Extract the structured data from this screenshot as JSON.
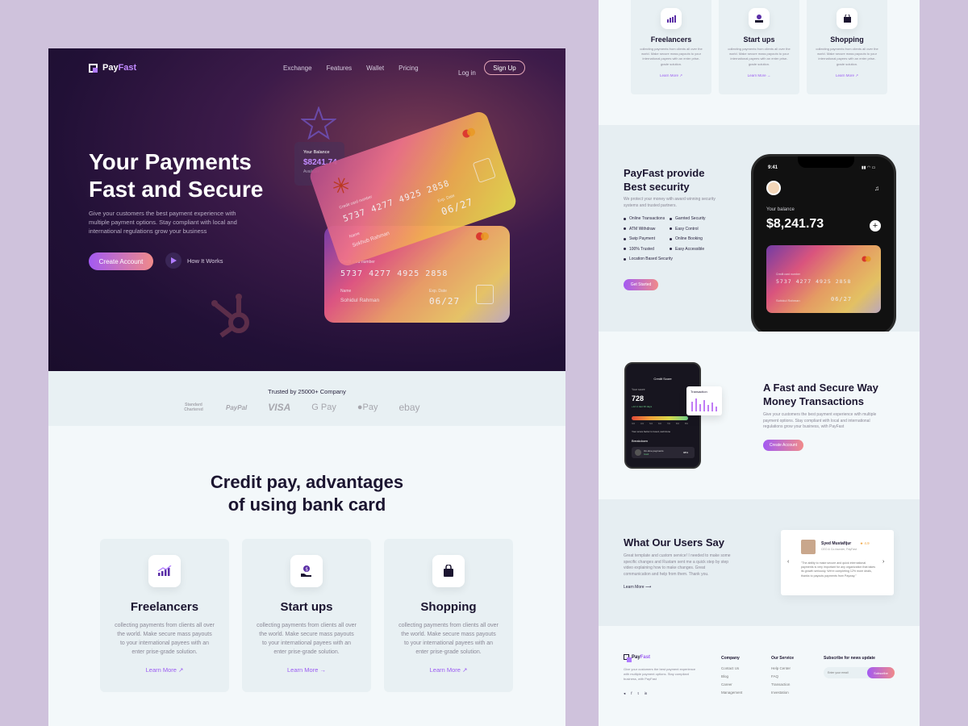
{
  "brand": {
    "name_a": "Pay",
    "name_b": "Fast"
  },
  "nav": {
    "items": [
      "Exchange",
      "Features",
      "Wallet",
      "Pricing"
    ],
    "login": "Log in",
    "signup": "Sign Up"
  },
  "hero": {
    "title_1": "Your Payments",
    "title_2": "Fast and Secure",
    "desc": "Give your customers the best payment experience with multiple payment options. Stay compliant with local and international regulations grow your business",
    "cta": "Create Account",
    "how": "How It Works",
    "balance": {
      "label": "Your Balance",
      "value": "$8241.74",
      "sub": "Available"
    },
    "card_front": {
      "label": "Credit card number",
      "number": "5737  4277  4925  2858",
      "exp_label": "Exp. Date",
      "exp": "06/27",
      "name_label": "Name",
      "name": "Sokhub Rahman"
    },
    "card_back": {
      "label": "Credit card number",
      "number": "5737  4277  4925  2858",
      "exp_label": "Exp. Date",
      "exp": "06/27",
      "name_label": "Name",
      "name": "Sohidul Rahman"
    }
  },
  "trusted": {
    "title": "Trusted by 25000+ Company",
    "logos": [
      "Standard Chartered",
      "PayPal",
      "VISA",
      "G Pay",
      "Pay",
      "ebay"
    ]
  },
  "features": {
    "title_1": "Credit pay, advantages",
    "title_2": "of using bank card",
    "learn": "Learn More",
    "items": [
      {
        "title": "Freelancers",
        "icon": "chart-icon",
        "desc": "collecting payments from clients all over the world. Make secure mass payouts to your international payees with an enter prise-grade solution."
      },
      {
        "title": "Start ups",
        "icon": "hand-coin-icon",
        "desc": "collecting payments from clients all over the world. Make secure mass payouts to your international payees with an enter prise-grade solution."
      },
      {
        "title": "Shopping",
        "icon": "bag-icon",
        "desc": "collecting payments from clients all over the world. Make secure mass payouts to your international payees with an enter prise-grade solution."
      }
    ]
  },
  "security": {
    "title_1": "PayFast provide",
    "title_2": "Best security",
    "desc": "We protect your money with award winning security systems and trusted partners.",
    "left": [
      "Online Transactions",
      "ATM Withdraw",
      "Swip Payment",
      "100% Trusted",
      "Location Based Security"
    ],
    "right": [
      "Garnted Security",
      "Easy Control",
      "Online Booking",
      "Easy Accessible"
    ],
    "cta": "Get Started",
    "phone": {
      "time": "9:41",
      "label": "Your balance",
      "value": "$8,241.73",
      "card_label": "Credit card number",
      "card_number": "5737  4277  4925  2858",
      "card_name": "Sohidul Rahman",
      "card_exp": "06/27"
    }
  },
  "transactions": {
    "title_1": "A Fast and Secure Way",
    "title_2": "Money Transactions",
    "desc": "Give your customers the best payment experience with multiple payment options. Stay compliant with local and international regulations grow your business, with PayFast",
    "cta": "Create Account",
    "phone": {
      "header": "Credit Score",
      "score_label": "Your score",
      "score": "728",
      "score_sub": "+12 in last 30 days",
      "scale": [
        "300",
        "400",
        "500",
        "600",
        "700",
        "800",
        "850"
      ],
      "good": "Your score factor is Good, well done",
      "breakdown": "Breakdown",
      "row": "On-time payments",
      "row_sub": "Good",
      "row_val": "98%"
    },
    "popup": {
      "title": "Transaction"
    }
  },
  "reviews": {
    "title": "What Our Users Say",
    "desc": "Great template and custom service! I needed to make some specific changes and Rustam sent me a quick step by step video explaining how to make changes. Great communication and help from them. Thank you.",
    "learn": "Learn More",
    "name": "Syed Mustafijur",
    "role": "CEO & Co-founder, PayFast",
    "rating": "4.9",
    "quote": "\"The ability to make secure and quick international payments is very important for any organization that takes its growth seriously. We're completing 12% more deals, thanks to payouts payments from Payway.\""
  },
  "footer": {
    "desc": "Give your customers the best payment experience with multiple payment options. Stay compliant business, with PayFast",
    "company_title": "Company",
    "company": [
      "Contact Us",
      "Blog",
      "Career",
      "Management"
    ],
    "service_title": "Our Service",
    "service": [
      "Help Center",
      "FAQ",
      "Transaction",
      "Investation"
    ],
    "subscribe_title": "Subscribe for news update",
    "placeholder": "Enter your email",
    "subscribe": "Subscribe"
  }
}
